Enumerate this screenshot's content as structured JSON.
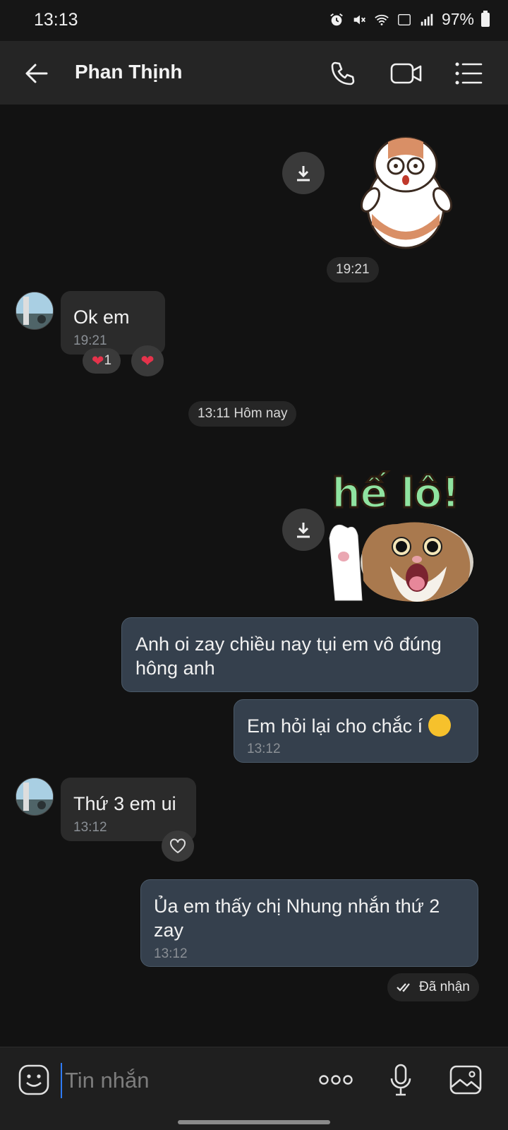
{
  "status_bar": {
    "time": "13:13",
    "battery": "97%"
  },
  "header": {
    "contact_name": "Phan Thịnh"
  },
  "messages": {
    "sticker1_time": "19:21",
    "msg1": {
      "text": "Ok em",
      "time": "19:21",
      "reaction_count": "1"
    },
    "date_divider": "13:11 Hôm nay",
    "sticker2_text": "hế lô!",
    "msg2": {
      "text_line1": "Anh oi zay chiều nay tụi em vô đúng",
      "text_line2": "hông anh"
    },
    "msg3": {
      "text": "Em hỏi lại cho chắc í",
      "time": "13:12"
    },
    "msg4": {
      "text": "Thứ 3 em ui",
      "time": "13:12"
    },
    "msg5": {
      "text_line1": "Ủa em thấy chị Nhung nhắn thứ 2",
      "text_line2": "zay",
      "time": "13:12"
    },
    "delivery_status": "Đã nhận"
  },
  "input": {
    "placeholder": "Tin nhắn"
  },
  "icons": {
    "back": "arrow-left-icon",
    "call": "phone-icon",
    "video": "video-camera-icon",
    "menu": "list-menu-icon",
    "download": "download-icon",
    "heart": "heart-icon",
    "emoji": "emoji-icon",
    "more": "more-dots-icon",
    "mic": "microphone-icon",
    "gallery": "image-gallery-icon"
  },
  "colors": {
    "background": "#121212",
    "outgoing_bubble": "#35404d",
    "incoming_bubble": "#2b2b2b",
    "accent": "#2e7bf6",
    "heart": "#e5334b"
  }
}
